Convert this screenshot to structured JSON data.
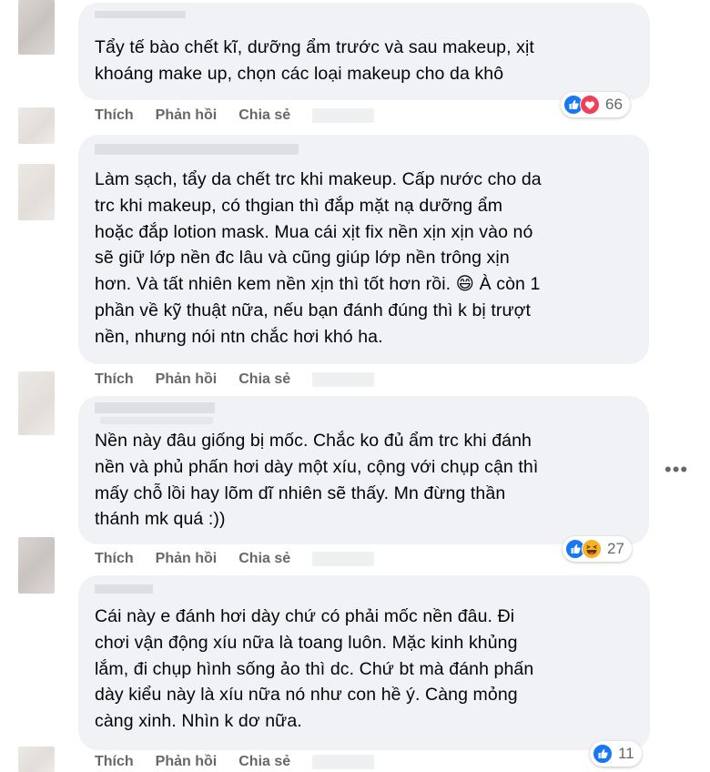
{
  "comments": [
    {
      "text": "Tẩy tế bào chết kĩ, dưỡng ẩm trước và sau makeup, xịt\nkhoáng make up, chọn các loại makeup cho da khô",
      "actions": {
        "like": "Thích",
        "reply": "Phản hồi",
        "share": "Chia sẻ"
      },
      "reaction_icons": [
        "like-icon",
        "love-icon"
      ],
      "reaction_count": "66"
    },
    {
      "text": "Làm sạch, tẩy da chết trc khi makeup. Cấp nước cho da\ntrc khi makeup, có thgian thì đắp mặt nạ dưỡng ẩm\nhoặc đắp lotion mask. Mua cái xịt fix nền xịn xịn vào nó\nsẽ giữ lớp nền đc lâu và cũng giúp lớp nền trông xịn\nhơn. Và tất nhiên kem nền xịn thì tốt hơn rồi. 😄 À còn 1\nphần về kỹ thuật nữa, nếu bạn đánh đúng thì k bị trượt\nnền, nhưng nói ntn chắc hơi khó ha.",
      "actions": {
        "like": "Thích",
        "reply": "Phản hồi",
        "share": "Chia sẻ"
      }
    },
    {
      "text": "Nền này đâu giống bị mốc. Chắc ko đủ ẩm trc khi đánh\nnền và phủ phấn hơi dày một xíu, cộng với chụp cận thì\nmấy chỗ lồi hay lõm dĩ nhiên sẽ thấy. Mn đừng thần\nthánh mk quá :))",
      "actions": {
        "like": "Thích",
        "reply": "Phản hồi",
        "share": "Chia sẻ"
      },
      "reaction_icons": [
        "like-icon",
        "haha-icon"
      ],
      "reaction_count": "27"
    },
    {
      "text": "Cái này e đánh hơi dày chứ có phải mốc nền đâu. Đi\nchơi vận động xíu nữa là toang luôn. Mặc kinh khủng\nlắm, đi chụp hình sống ảo thì dc. Chứ bt mà đánh phấn\ndày kiểu này là xíu nữa nó như con hề ý. Càng mỏng\ncàng xinh. Nhìn k dơ nữa.",
      "actions": {
        "like": "Thích",
        "reply": "Phản hồi",
        "share": "Chia sẻ"
      },
      "reaction_icons": [
        "like-icon"
      ],
      "reaction_count": "11"
    }
  ],
  "more_options": "•••",
  "colors": {
    "bubble": "#f0f2f5",
    "action_text": "#65676b",
    "like_blue": "#1877f2",
    "love_red": "#f33e58",
    "haha_yellow": "#f7b125"
  }
}
